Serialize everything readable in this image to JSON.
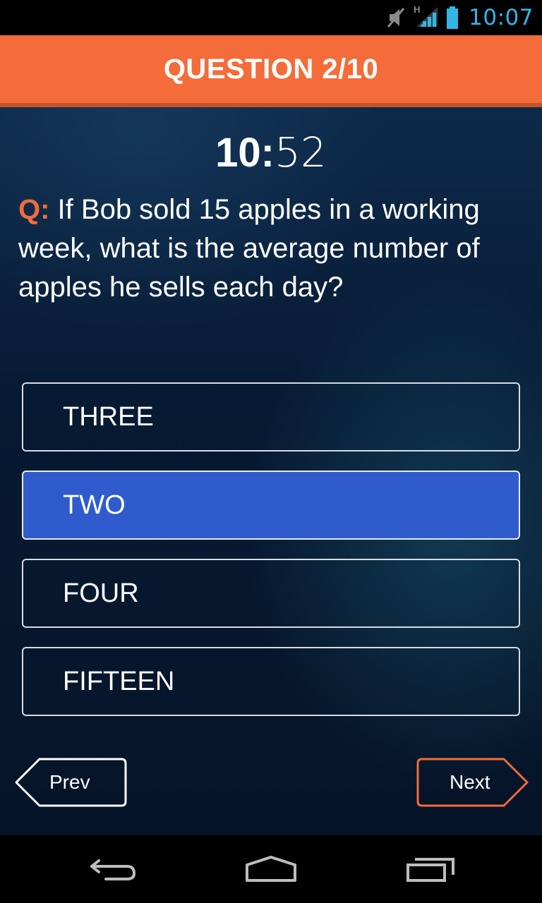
{
  "status_bar": {
    "time": "10:07",
    "network_label": "H",
    "icons": [
      "mute-icon",
      "signal-icon",
      "battery-icon"
    ]
  },
  "header": {
    "title": "QUESTION 2/10"
  },
  "timer": {
    "minutes": "10:",
    "seconds": "52"
  },
  "question": {
    "prefix": "Q:",
    "text": " If Bob sold 15 apples in a working week, what is the average number of apples he sells each day?"
  },
  "answers": [
    {
      "label": "THREE",
      "selected": false
    },
    {
      "label": "TWO",
      "selected": true
    },
    {
      "label": "FOUR",
      "selected": false
    },
    {
      "label": "FIFTEEN",
      "selected": false
    }
  ],
  "navigation": {
    "prev_label": "Prev",
    "next_label": "Next"
  },
  "system_nav": {
    "icons": [
      "back-icon",
      "home-icon",
      "recent-apps-icon"
    ]
  },
  "colors": {
    "accent": "#f36c39",
    "selected": "#2f5bcd",
    "clock": "#33b5e5"
  }
}
